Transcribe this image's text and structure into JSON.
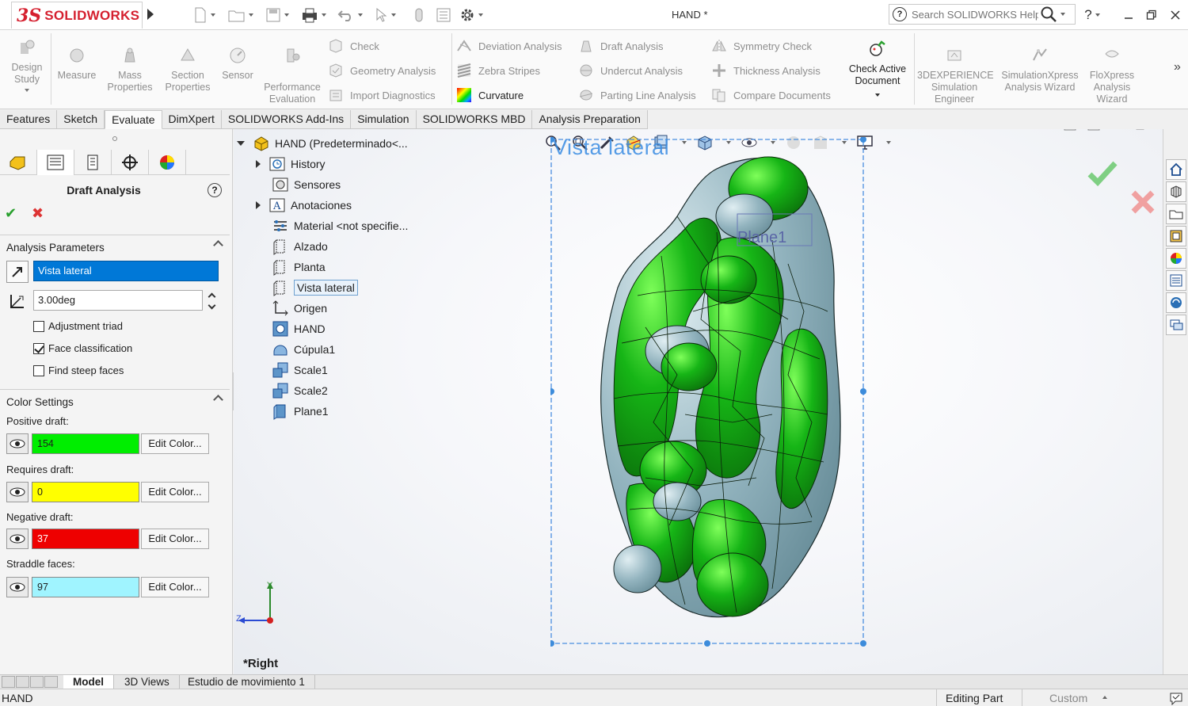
{
  "app": {
    "logo_ds": "3S",
    "logo_text": "SOLIDWORKS",
    "document_title": "HAND *",
    "search_placeholder": "Search SOLIDWORKS Help"
  },
  "ribbon": {
    "design_study": "Design Study",
    "measure": "Measure",
    "mass_properties": "Mass Properties",
    "section_properties": "Section Properties",
    "sensor": "Sensor",
    "performance_evaluation": "Performance Evaluation",
    "check": "Check",
    "geometry_analysis": "Geometry Analysis",
    "import_diagnostics": "Import Diagnostics",
    "deviation_analysis": "Deviation Analysis",
    "zebra_stripes": "Zebra Stripes",
    "curvature": "Curvature",
    "draft_analysis": "Draft Analysis",
    "undercut_analysis": "Undercut Analysis",
    "parting_line_analysis": "Parting Line Analysis",
    "symmetry_check": "Symmetry Check",
    "thickness_analysis": "Thickness Analysis",
    "compare_documents": "Compare Documents",
    "check_active_document": "Check Active Document",
    "experience_simulation": "3DEXPERIENCE Simulation Engineer",
    "simulationxpress": "SimulationXpress Analysis Wizard",
    "floxpress": "FloXpress Analysis Wizard"
  },
  "tabs": [
    "Features",
    "Sketch",
    "Evaluate",
    "DimXpert",
    "SOLIDWORKS Add-Ins",
    "Simulation",
    "SOLIDWORKS MBD",
    "Analysis Preparation"
  ],
  "active_tab": "Evaluate",
  "property_manager": {
    "title": "Draft Analysis",
    "analysis_parameters_header": "Analysis Parameters",
    "direction_value": "Vista lateral",
    "angle_value": "3.00deg",
    "adjustment_triad": "Adjustment triad",
    "adjustment_triad_checked": false,
    "face_classification": "Face classification",
    "face_classification_checked": true,
    "find_steep_faces": "Find steep faces",
    "find_steep_faces_checked": false,
    "color_settings_header": "Color Settings",
    "edit_color_label": "Edit Color...",
    "colors": [
      {
        "label": "Positive draft:",
        "count": "154",
        "color": "#00ee00"
      },
      {
        "label": "Requires draft:",
        "count": "0",
        "color": "#ffff00"
      },
      {
        "label": "Negative draft:",
        "count": "37",
        "color": "#ee0000"
      },
      {
        "label": "Straddle faces:",
        "count": "97",
        "color": "#a0f4ff"
      }
    ]
  },
  "feature_tree": [
    {
      "label": "HAND  (Predeterminado<...",
      "icon": "part-icon",
      "expander": "down"
    },
    {
      "label": "History",
      "icon": "history-icon",
      "expander": "right"
    },
    {
      "label": "Sensores",
      "icon": "sensor-icon",
      "expander": "none"
    },
    {
      "label": "Anotaciones",
      "icon": "annotation-icon",
      "expander": "right"
    },
    {
      "label": "Material <not specifie...",
      "icon": "material-icon",
      "expander": "none"
    },
    {
      "label": "Alzado",
      "icon": "plane-icon",
      "expander": "none"
    },
    {
      "label": "Planta",
      "icon": "plane-icon",
      "expander": "none"
    },
    {
      "label": "Vista lateral",
      "icon": "plane-icon",
      "expander": "none",
      "selected": true
    },
    {
      "label": "Origen",
      "icon": "origin-icon",
      "expander": "none"
    },
    {
      "label": "HAND",
      "icon": "imported-body-icon",
      "expander": "none"
    },
    {
      "label": "Cúpula1",
      "icon": "dome-icon",
      "expander": "none"
    },
    {
      "label": "Scale1",
      "icon": "scale-icon",
      "expander": "none"
    },
    {
      "label": "Scale2",
      "icon": "scale-icon",
      "expander": "none"
    },
    {
      "label": "Plane1",
      "icon": "plane-feature-icon",
      "expander": "none"
    }
  ],
  "viewport": {
    "plane_label_vista": "Vista lateral",
    "plane_label_plane1": "Plane1",
    "view_name": "*Right",
    "triad_y": "Y",
    "triad_z": "Z"
  },
  "bottom_tabs": [
    "Model",
    "3D Views",
    "Estudio de movimiento 1"
  ],
  "active_bottom_tab": "Model",
  "status": {
    "left": "HAND",
    "editing": "Editing Part",
    "units": "Custom"
  }
}
